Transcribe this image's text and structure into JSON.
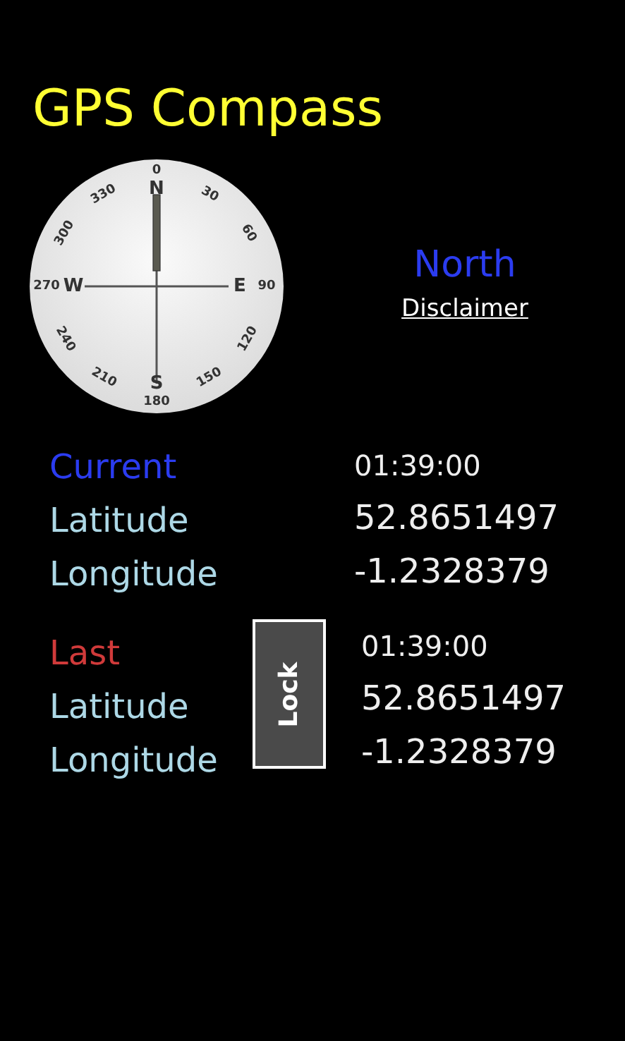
{
  "title": "GPS Compass",
  "dial": {
    "degrees": [
      "0",
      "30",
      "60",
      "90",
      "120",
      "150",
      "180",
      "210",
      "240",
      "270",
      "300",
      "330"
    ],
    "cardinals": [
      "N",
      "E",
      "S",
      "W"
    ]
  },
  "direction": "North",
  "disclaimer_link": "Disclaimer",
  "current": {
    "heading": "Current",
    "time": "01:39:00",
    "latitude_label": "Latitude",
    "latitude": "52.8651497",
    "longitude_label": "Longitude",
    "longitude": "-1.2328379"
  },
  "last": {
    "heading": "Last",
    "time": "01:39:00",
    "latitude_label": "Latitude",
    "latitude": "52.8651497",
    "longitude_label": "Longitude",
    "longitude": "-1.2328379"
  },
  "lock_button": "Lock"
}
